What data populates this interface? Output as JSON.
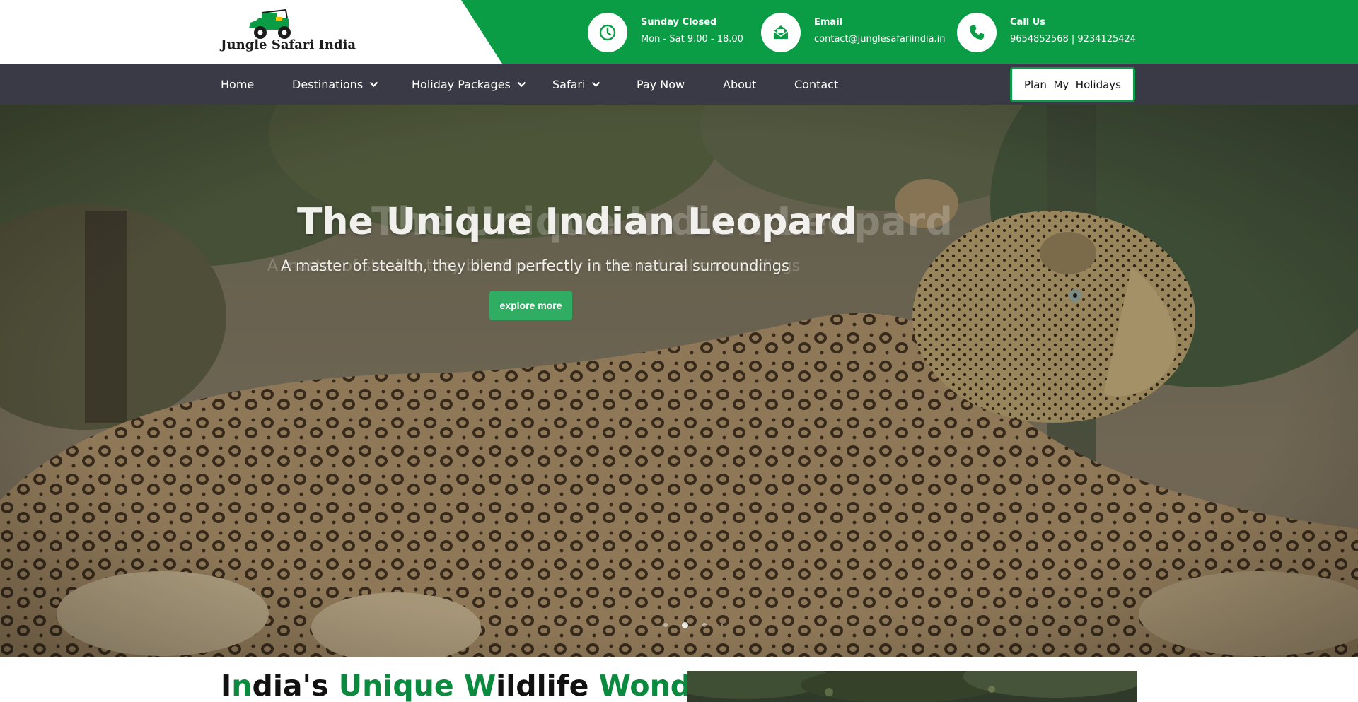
{
  "brand": {
    "name": "Jungle Safari India",
    "logo_icon": "safari-jeep-icon",
    "green": "#0a9d46",
    "nav_bg": "#393a45"
  },
  "contact_bar": {
    "hours": {
      "icon": "clock-icon",
      "title": "Sunday Closed",
      "text": "Mon - Sat 9.00 - 18.00"
    },
    "email": {
      "icon": "envelope-open-icon",
      "title": "Email",
      "text": "contact@junglesafariindia.in"
    },
    "phone": {
      "icon": "phone-icon",
      "title": "Call Us",
      "text": "9654852568  |  9234125424"
    }
  },
  "nav": {
    "items": [
      {
        "label": "Home",
        "has_dropdown": false
      },
      {
        "label": "Destinations",
        "has_dropdown": true
      },
      {
        "label": "Holiday Packages",
        "has_dropdown": true
      },
      {
        "label": "Safari",
        "has_dropdown": true
      },
      {
        "label": "Pay Now",
        "has_dropdown": false
      },
      {
        "label": "About",
        "has_dropdown": false
      },
      {
        "label": "Contact",
        "has_dropdown": false
      }
    ],
    "cta_label": "Plan  My  Holidays"
  },
  "hero": {
    "title": "The Unique Indian Leopard",
    "subtitle": "A master of stealth, they blend perfectly in the natural surroundings",
    "button_label": "explore more",
    "slides_total": 4,
    "active_slide": 2
  },
  "section": {
    "title_parts": [
      {
        "text": "I",
        "green": false
      },
      {
        "text": "n",
        "green": true
      },
      {
        "text": "dia's ",
        "green": false
      },
      {
        "text": "Unique ",
        "green": true
      },
      {
        "text": "W",
        "green": true
      },
      {
        "text": "ildlife ",
        "green": false
      },
      {
        "text": "Wonders",
        "green": true
      }
    ]
  }
}
